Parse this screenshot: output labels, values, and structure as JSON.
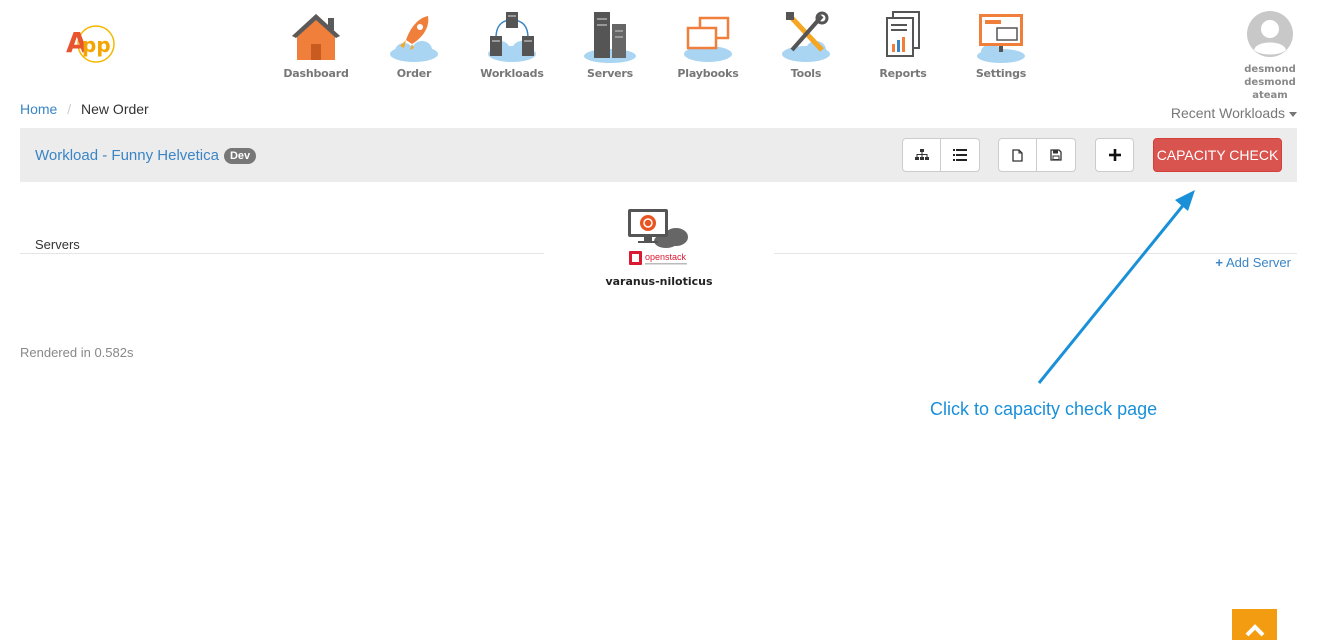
{
  "app": {
    "logo_text": "App"
  },
  "nav": [
    {
      "label": "Dashboard",
      "icon": "house-icon"
    },
    {
      "label": "Order",
      "icon": "rocket-icon"
    },
    {
      "label": "Workloads",
      "icon": "network-servers-icon"
    },
    {
      "label": "Servers",
      "icon": "server-rack-icon"
    },
    {
      "label": "Playbooks",
      "icon": "playbook-windows-icon"
    },
    {
      "label": "Tools",
      "icon": "tools-icon"
    },
    {
      "label": "Reports",
      "icon": "report-document-icon"
    },
    {
      "label": "Settings",
      "icon": "settings-monitor-icon"
    }
  ],
  "user": {
    "name": "desmond desmond",
    "team": "ateam"
  },
  "breadcrumb": {
    "home": "Home",
    "separator": "/",
    "current": "New Order"
  },
  "recent_workloads": {
    "label": "Recent Workloads"
  },
  "workload": {
    "title": "Workload - Funny Helvetica",
    "badge": "Dev",
    "capacity_button": "CAPACITY CHECK"
  },
  "servers": {
    "label": "Servers",
    "add_label": "Add Server",
    "items": [
      {
        "name": "varanus-niloticus",
        "platform": "openstack",
        "os_icon": "ubuntu-icon"
      }
    ]
  },
  "footer": {
    "rendered": "Rendered in 0.582s"
  },
  "annotation": {
    "text": "Click to capacity check page"
  },
  "colors": {
    "link": "#3a85c6",
    "danger": "#d9534f",
    "accent": "#f39c12",
    "annotation": "#1a90d9"
  }
}
